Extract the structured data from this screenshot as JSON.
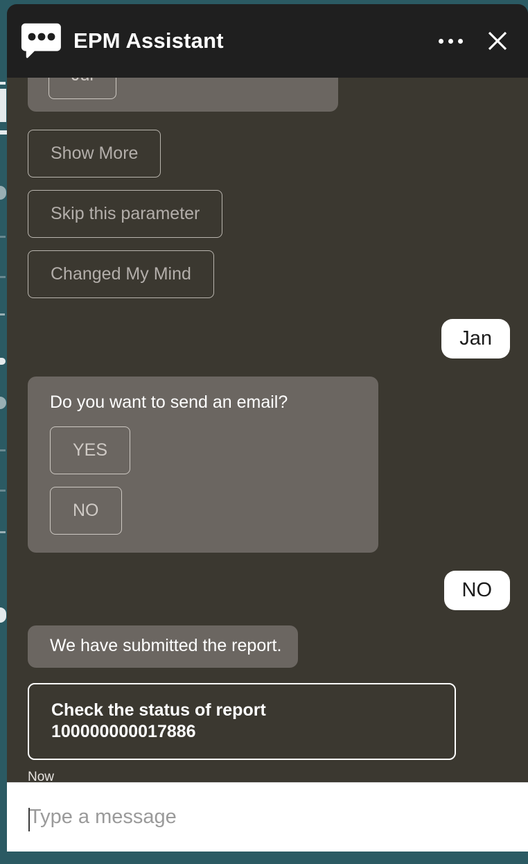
{
  "window": {
    "title": "EPM Assistant",
    "brand_icon": "chat-bubble-dots-icon",
    "more_options_label": "…",
    "close_label": "✕",
    "panel_bg": "#3b3830",
    "header_bg": "#1f1f1f",
    "page_bg": "#2b5a63",
    "bot_bubble_bg": "#6b6661",
    "user_bubble_bg": "#ffffff",
    "accent": "#ffffff"
  },
  "conversation": {
    "clipped_prompt": {
      "chip_label": "Jul"
    },
    "quick_replies": [
      {
        "label": "Show More"
      },
      {
        "label": "Skip this parameter"
      },
      {
        "label": "Changed My Mind"
      }
    ],
    "messages": [
      {
        "role": "user",
        "text": "Jan"
      },
      {
        "role": "bot",
        "text": "Do you want to send an email?",
        "options": [
          {
            "label": "YES"
          },
          {
            "label": "NO"
          }
        ]
      },
      {
        "role": "user",
        "text": "NO"
      },
      {
        "role": "bot",
        "text": "We have submitted the report."
      }
    ],
    "suggestion": {
      "line1": "Check the status of report",
      "line2": "100000000017886"
    },
    "timestamp": "Now"
  },
  "composer": {
    "placeholder": "Type a message",
    "value": ""
  }
}
